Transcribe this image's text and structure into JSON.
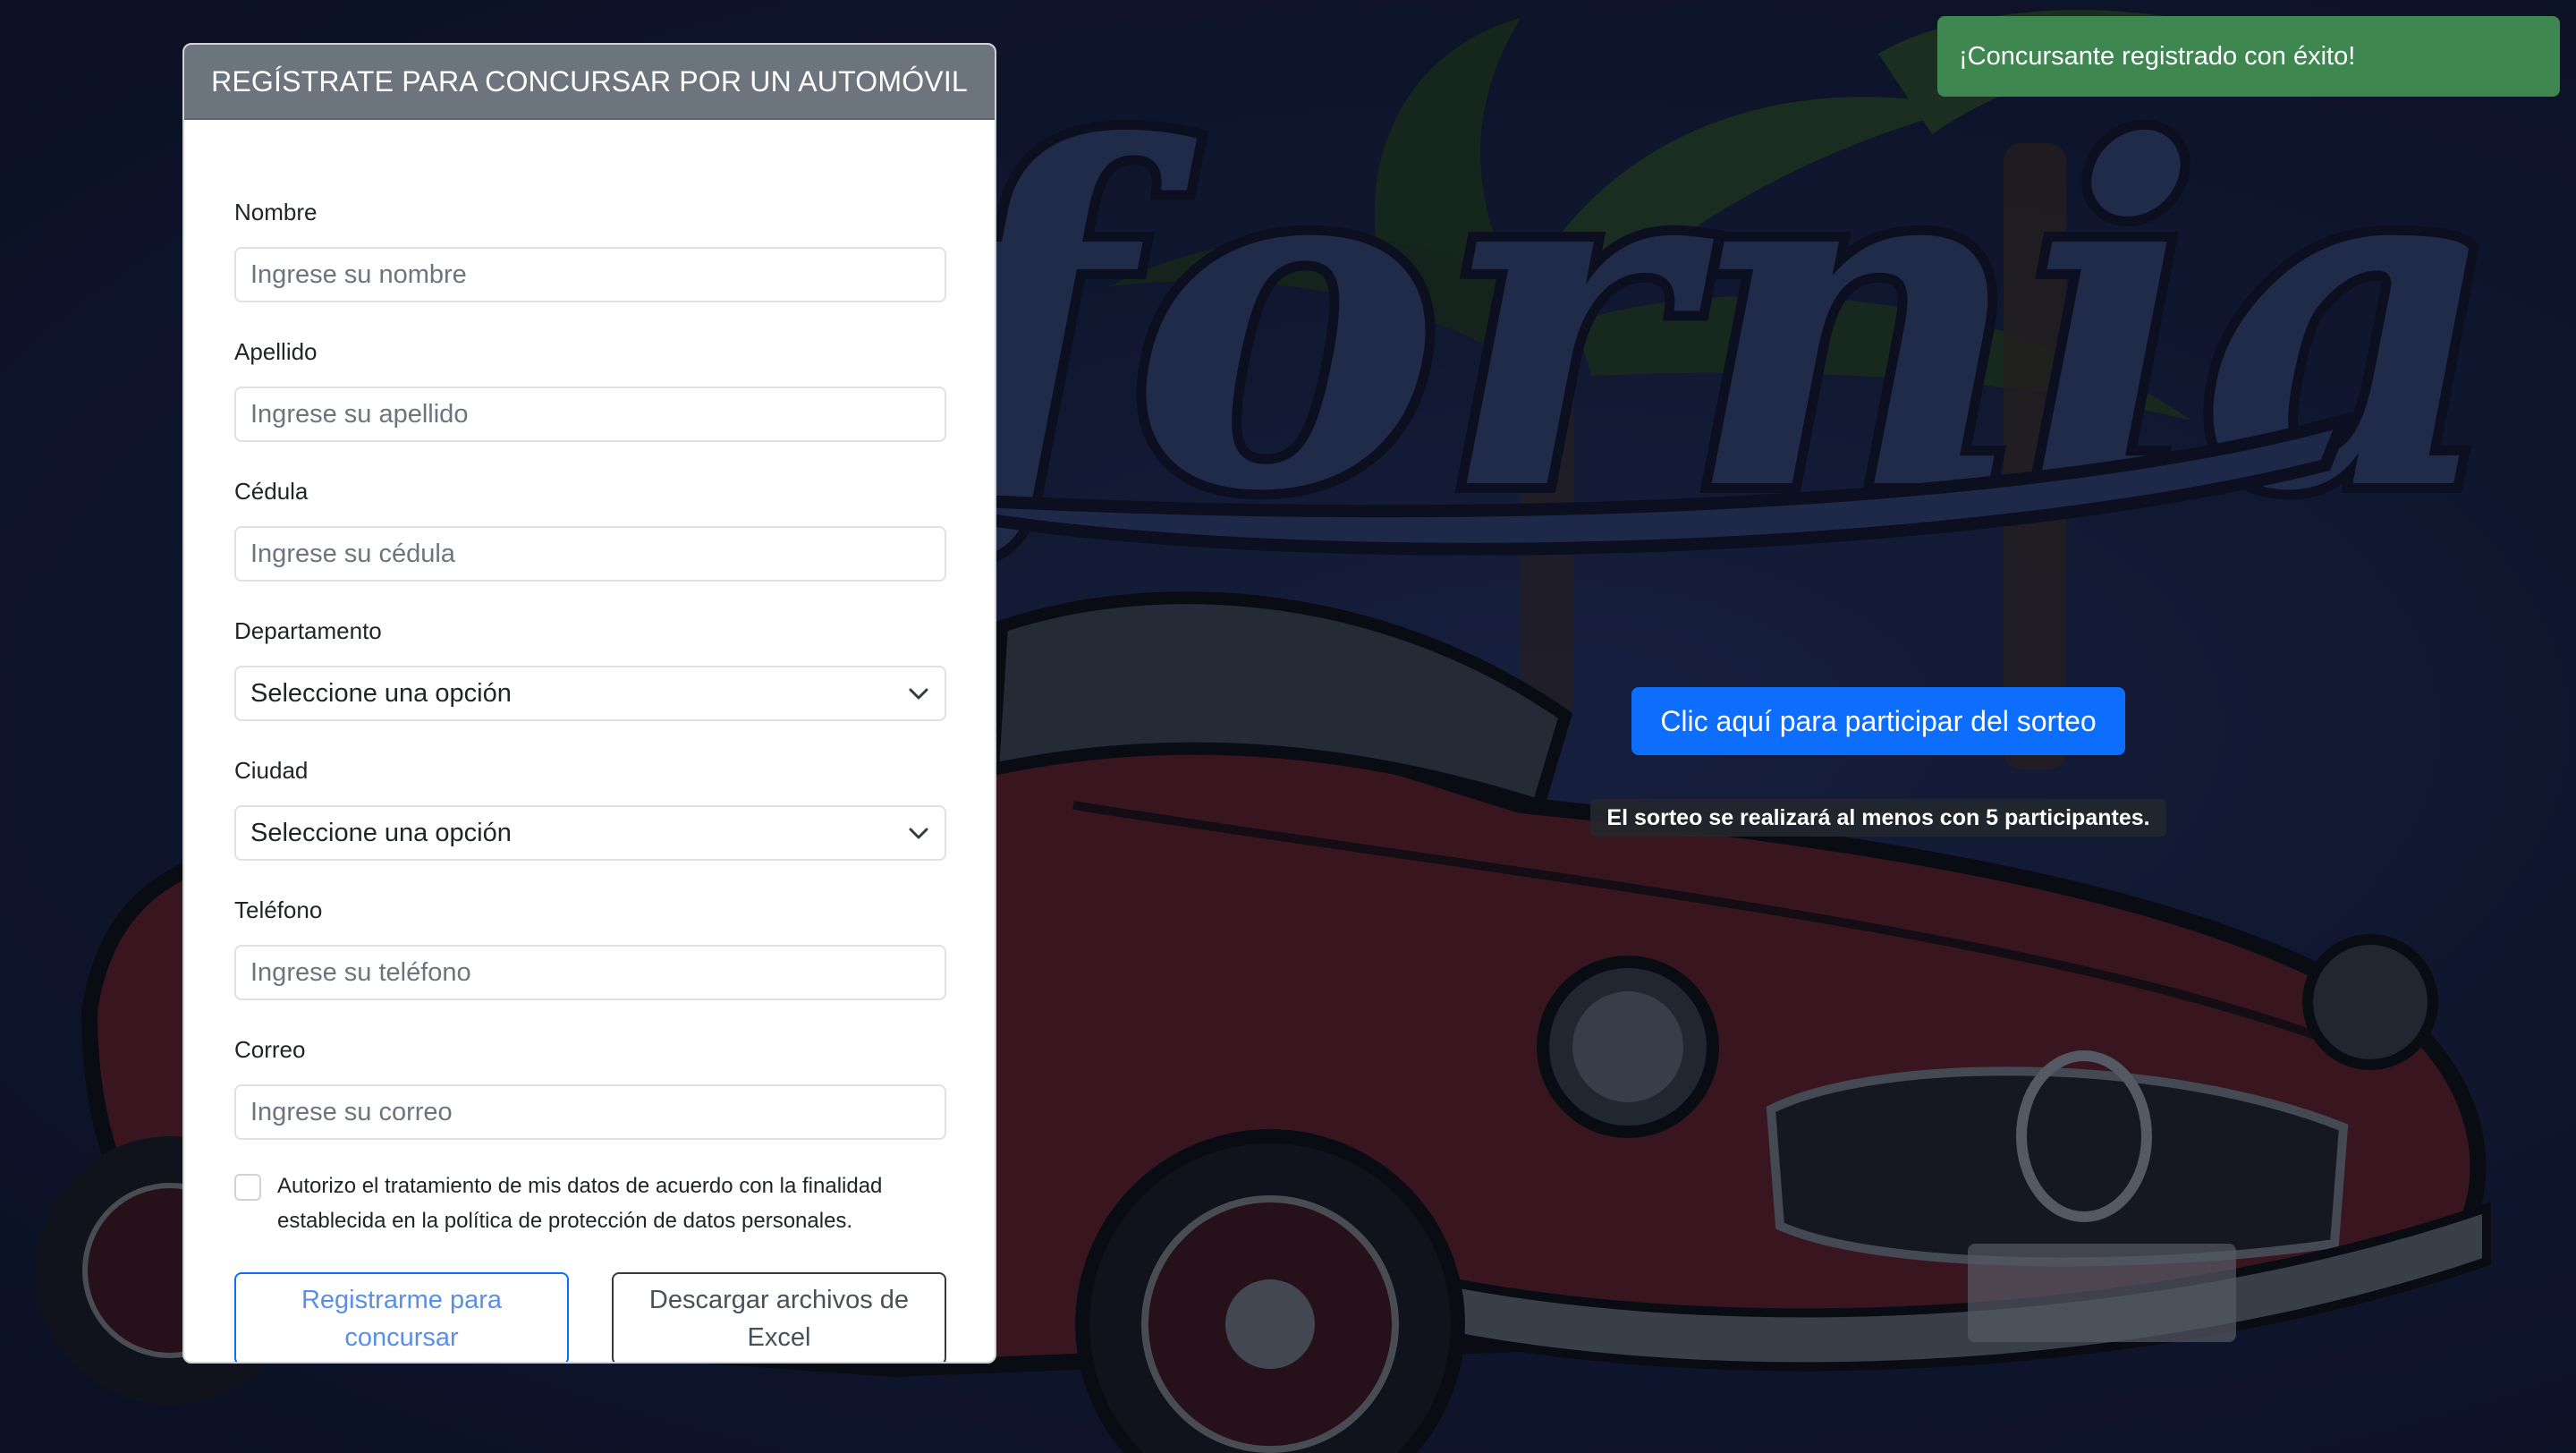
{
  "form": {
    "title": "REGÍSTRATE PARA CONCURSAR POR UN AUTOMÓVIL",
    "fields": [
      {
        "label": "Nombre",
        "placeholder": "Ingrese su nombre"
      },
      {
        "label": "Apellido",
        "placeholder": "Ingrese su apellido"
      },
      {
        "label": "Cédula",
        "placeholder": "Ingrese su cédula"
      },
      {
        "label": "Departamento",
        "value": "Seleccione una opción"
      },
      {
        "label": "Ciudad",
        "value": "Seleccione una opción"
      },
      {
        "label": "Teléfono",
        "placeholder": "Ingrese su teléfono"
      },
      {
        "label": "Correo",
        "placeholder": "Ingrese su correo"
      }
    ],
    "consent": {
      "line1": "Autorizo el tratamiento de mis datos de acuerdo con la finalidad",
      "line2": "establecida en la política de protección de datos personales.",
      "checked": false
    },
    "register_button": {
      "line1": "Registrarme para",
      "line2": "concursar"
    },
    "download_button": {
      "line1": "Descargar archivos de",
      "line2": "Excel"
    }
  },
  "toast": {
    "message": "¡Concursante registrado con éxito!",
    "color": "#3f8751"
  },
  "raffle": {
    "button_label": "Clic aquí para participar del sorteo",
    "note": "El sorteo se realizará al menos con 5 participantes."
  },
  "background": {
    "artwork_text": "fornia"
  },
  "colors": {
    "primary": "#0d6efd",
    "header": "#6c757d",
    "success": "#3f8751"
  },
  "icons": {
    "select_arrow": "chevron-down-icon",
    "consent": "checkbox-icon"
  }
}
